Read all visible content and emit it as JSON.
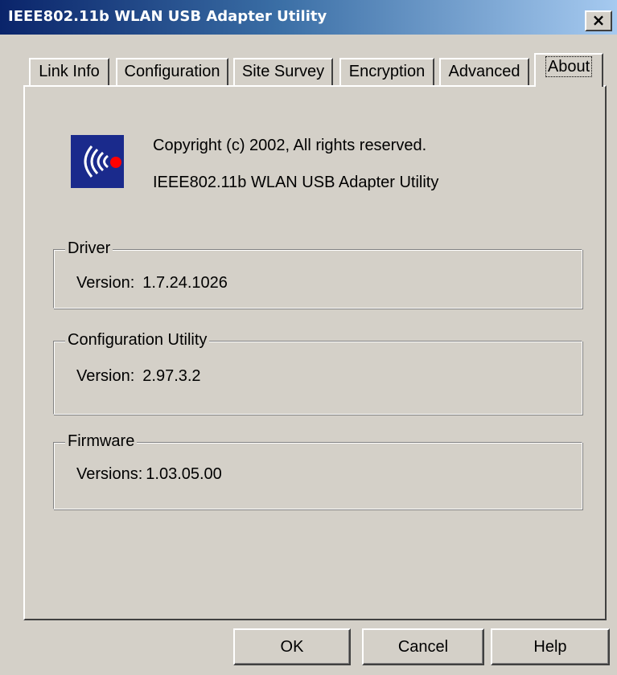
{
  "window": {
    "title": "IEEE802.11b WLAN USB Adapter Utility",
    "close_label": "×"
  },
  "tabs": [
    {
      "label": "Link Info"
    },
    {
      "label": "Configuration"
    },
    {
      "label": "Site Survey"
    },
    {
      "label": "Encryption"
    },
    {
      "label": "Advanced"
    },
    {
      "label": "About",
      "active": true
    }
  ],
  "about": {
    "logo_icon": "wireless-signal-icon",
    "logo_colors": {
      "background": "#1a2a8c",
      "waves": "#ffffff",
      "dot": "#ff0000"
    },
    "copyright": "Copyright (c) 2002, All rights reserved.",
    "product": "IEEE802.11b WLAN USB Adapter Utility"
  },
  "driver": {
    "label": "Driver",
    "version_label": "Version:",
    "version": "1.7.24.1026"
  },
  "config_utility": {
    "label": "Configuration Utility",
    "version_label": "Version:",
    "version": "2.97.3.2"
  },
  "firmware": {
    "label": "Firmware",
    "version_label": "Versions:",
    "version": "1.03.05.00"
  },
  "buttons": {
    "ok": "OK",
    "cancel": "Cancel",
    "help": "Help"
  }
}
